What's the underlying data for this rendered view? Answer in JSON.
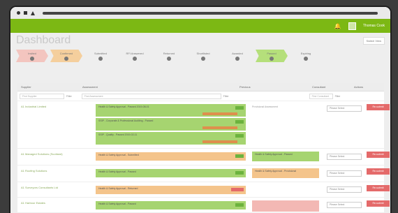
{
  "header": {
    "title": "Dashboard",
    "view_button": "Switch View",
    "username": "Thomas Cook"
  },
  "steps": [
    {
      "label": "Invited",
      "color": "#f3c5bf"
    },
    {
      "label": "Confirmed",
      "color": "#f5cf9d"
    },
    {
      "label": "Submitted",
      "color": "#eeeeee"
    },
    {
      "label": "RFI Answered",
      "color": "#eeeeee"
    },
    {
      "label": "Returned",
      "color": "#eeeeee"
    },
    {
      "label": "Shortlisted",
      "color": "#eeeeee"
    },
    {
      "label": "Awarded",
      "color": "#eeeeee"
    },
    {
      "label": "Passed",
      "color": "#b5df7b"
    },
    {
      "label": "Expiring",
      "color": "#eeeeee"
    }
  ],
  "table": {
    "headers": [
      "Supplier",
      "Assessment",
      "Previous",
      "Consultant",
      "Actions"
    ],
    "filter_placeholders": [
      "Find Supplier",
      "Find Assessment",
      "",
      "Find Consultant"
    ],
    "filter_link": "Filter",
    "select_label": "Please Select",
    "action_label": "Re-submit",
    "suppliers": [
      "A1 Industrial Limited",
      "A1 Managed Solutions (Scotland)",
      "A1 Roofing Solutions",
      "A1 Surveyors Consultants Ltd",
      "A1 Harbour Estates"
    ],
    "assessments": [
      "Health & Safety Approval - Passed 2019-08-01",
      "SSIP - Corporate & Professional Auditing - Passed",
      "SSIP - Quality - Passed 2019-02-11",
      "Health & Safety Approval - Submitted",
      "Health & Safety Approval - Passed",
      "Health & Safety Approval - Returned"
    ],
    "previous": [
      "Provisional Assessment",
      "Health & Safety Approval - Passed",
      "Health & Safety Approval - Provisional"
    ]
  }
}
